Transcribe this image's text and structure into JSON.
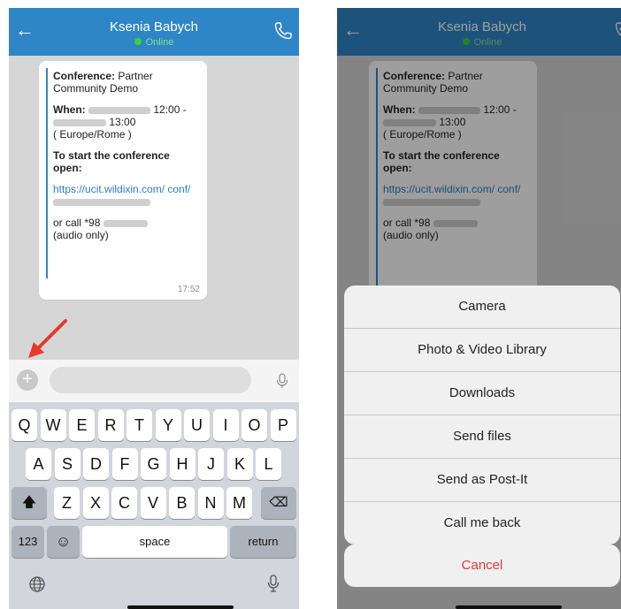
{
  "chat": {
    "contact_name": "Ksenia Babych",
    "status": "Online",
    "message": {
      "conference_label": "Conference:",
      "conference_name": "Partner Community Demo",
      "when_label": "When:",
      "time_start": "12:00 -",
      "time_end": "13:00",
      "timezone": "( Europe/Rome )",
      "start_heading": "To start the conference open:",
      "url": "https://ucit.wildixin.com/ conf/",
      "call_prefix": "or call *98",
      "call_note": "(audio only)",
      "timestamp": "17:52"
    }
  },
  "keyboard": {
    "row1": [
      "Q",
      "W",
      "E",
      "R",
      "T",
      "Y",
      "U",
      "I",
      "O",
      "P"
    ],
    "row2": [
      "A",
      "S",
      "D",
      "F",
      "G",
      "H",
      "J",
      "K",
      "L"
    ],
    "row3": [
      "Z",
      "X",
      "C",
      "V",
      "B",
      "N",
      "M"
    ],
    "numbers_key": "123",
    "space_key": "space",
    "return_key": "return"
  },
  "action_sheet": {
    "options": [
      "Camera",
      "Photo & Video Library",
      "Downloads",
      "Send files",
      "Send as Post-It",
      "Call me back"
    ],
    "cancel": "Cancel"
  },
  "colors": {
    "header": "#2f86c7",
    "online": "#3cd13c",
    "annotation_arrow": "#e8392c",
    "cancel_text": "#e23a2f"
  }
}
